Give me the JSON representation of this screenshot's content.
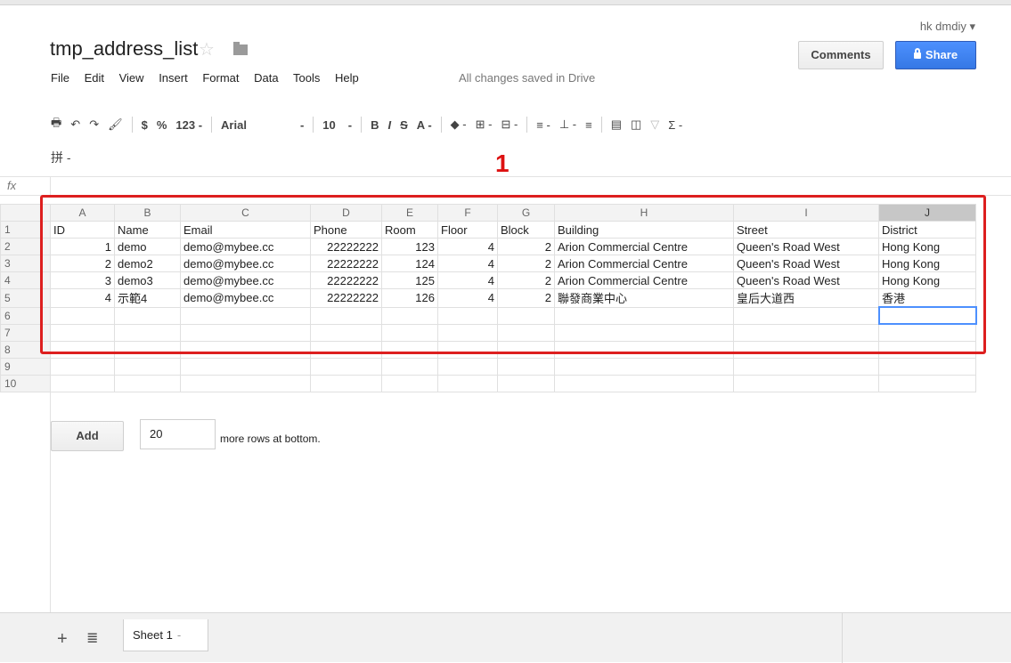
{
  "doc": {
    "title": "tmp_address_list",
    "user": "hk dmdiy",
    "star_icon": "star-icon",
    "folder_icon": "folder-icon"
  },
  "actions": {
    "comments": "Comments",
    "share": "Share",
    "share_icon": "lock-icon"
  },
  "menu": [
    "File",
    "Edit",
    "View",
    "Insert",
    "Format",
    "Data",
    "Tools",
    "Help"
  ],
  "status": "All changes saved in Drive",
  "toolbar": {
    "currency": "$",
    "percent": "%",
    "number_format": "123 -",
    "font": "Arial",
    "font_caret": "-",
    "size": "10",
    "size_caret": "-",
    "bold": "B",
    "italic": "I",
    "strike": "S",
    "text_color": "A -",
    "fill": "◆ -",
    "borders": "⊞ -",
    "merge": "⊟ -",
    "align": "≡ -",
    "valign": "⊥ -",
    "wrap": "≡",
    "functions": "Σ -",
    "pinyin": "拼 -"
  },
  "annotation": "1",
  "formula_bar": {
    "label": "fx",
    "value": ""
  },
  "grid": {
    "columns": [
      "A",
      "B",
      "C",
      "D",
      "E",
      "F",
      "G",
      "H",
      "I",
      "J"
    ],
    "selected_column": "J",
    "rows": [
      [
        "1",
        "ID",
        "Name",
        "Email",
        "Phone",
        "Room",
        "Floor",
        "Block",
        "Building",
        "Street",
        "District"
      ],
      [
        "2",
        "1",
        "demo",
        "demo@mybee.cc",
        "22222222",
        "123",
        "4",
        "2",
        "Arion Commercial Centre",
        "Queen's Road West",
        "Hong Kong"
      ],
      [
        "3",
        "2",
        "demo2",
        "demo@mybee.cc",
        "22222222",
        "124",
        "4",
        "2",
        "Arion Commercial Centre",
        "Queen's Road West",
        "Hong Kong"
      ],
      [
        "4",
        "3",
        "demo3",
        "demo@mybee.cc",
        "22222222",
        "125",
        "4",
        "2",
        "Arion Commercial Centre",
        "Queen's Road West",
        "Hong Kong"
      ],
      [
        "5",
        "4",
        "示範4",
        "demo@mybee.cc",
        "22222222",
        "126",
        "4",
        "2",
        "聯發商業中心",
        "皇后大道西",
        "香港"
      ],
      [
        "6",
        "",
        "",
        "",
        "",
        "",
        "",
        "",
        "",
        "",
        ""
      ],
      [
        "7",
        "",
        "",
        "",
        "",
        "",
        "",
        "",
        "",
        "",
        ""
      ],
      [
        "8",
        "",
        "",
        "",
        "",
        "",
        "",
        "",
        "",
        "",
        ""
      ],
      [
        "9",
        "",
        "",
        "",
        "",
        "",
        "",
        "",
        "",
        "",
        ""
      ],
      [
        "10",
        "",
        "",
        "",
        "",
        "",
        "",
        "",
        "",
        "",
        ""
      ]
    ],
    "active_cell": "J6"
  },
  "add_rows": {
    "button": "Add",
    "count": "20",
    "suffix": "more rows at bottom."
  },
  "sheets": {
    "add_icon": "+",
    "list_icon": "≣",
    "tabs": [
      "Sheet 1"
    ],
    "tab_caret": "-"
  },
  "colors": {
    "accent": "#4d90fe",
    "annotation": "#dd1f1f"
  }
}
